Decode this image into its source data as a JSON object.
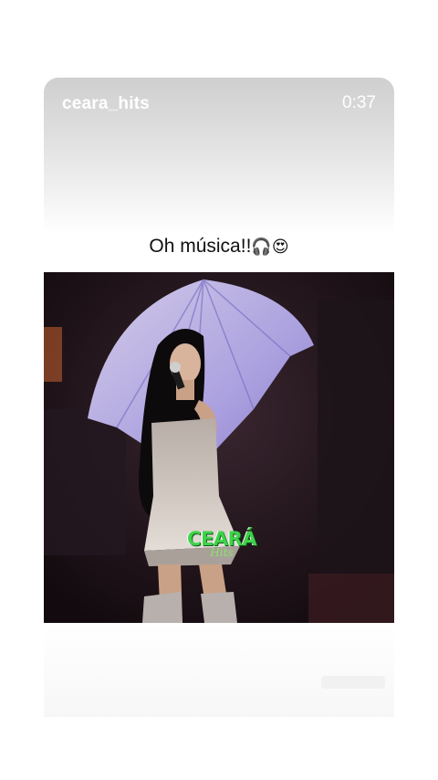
{
  "story": {
    "username": "ceara_hits",
    "time": "0:37",
    "caption_text": "Oh música!!",
    "caption_emojis": "🎧😍"
  },
  "video": {
    "watermark_main": "CEARÁ",
    "watermark_sub": "Hits",
    "colors": {
      "background": "#1a0f14",
      "umbrella": "#c9c0f2",
      "dress": "#cfc6c0",
      "watermark": "#3fd24a"
    }
  }
}
